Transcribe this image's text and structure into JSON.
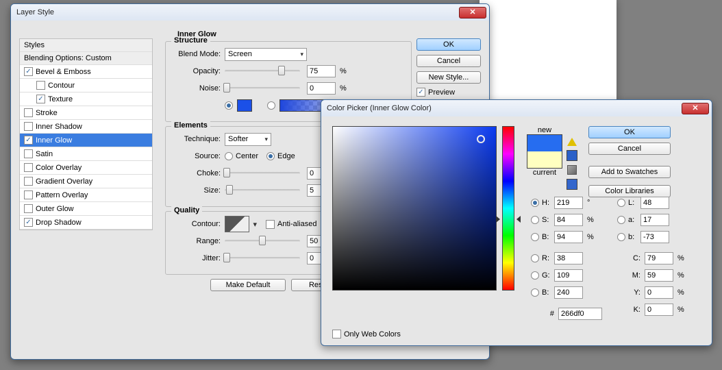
{
  "ls": {
    "title": "Layer Style",
    "panel_head": "Styles",
    "blend_opts": "Blending Options: Custom",
    "items": {
      "bevel": {
        "label": "Bevel & Emboss",
        "on": true
      },
      "contour": {
        "label": "Contour",
        "on": false
      },
      "texture": {
        "label": "Texture",
        "on": true
      },
      "stroke": {
        "label": "Stroke",
        "on": false
      },
      "innershadow": {
        "label": "Inner Shadow",
        "on": false
      },
      "innerglow": {
        "label": "Inner Glow",
        "on": true
      },
      "satin": {
        "label": "Satin",
        "on": false
      },
      "coloroverlay": {
        "label": "Color Overlay",
        "on": false
      },
      "gradoverlay": {
        "label": "Gradient Overlay",
        "on": false
      },
      "patoverlay": {
        "label": "Pattern Overlay",
        "on": false
      },
      "outerglow": {
        "label": "Outer Glow",
        "on": false
      },
      "dropshadow": {
        "label": "Drop Shadow",
        "on": true
      }
    },
    "section": "Inner Glow",
    "structure": {
      "legend": "Structure",
      "blendmode_lbl": "Blend Mode:",
      "blendmode": "Screen",
      "opacity_lbl": "Opacity:",
      "opacity": "75",
      "noise_lbl": "Noise:",
      "noise": "0",
      "pct": "%"
    },
    "elements": {
      "legend": "Elements",
      "technique_lbl": "Technique:",
      "technique": "Softer",
      "source_lbl": "Source:",
      "center": "Center",
      "edge": "Edge",
      "choke_lbl": "Choke:",
      "choke": "0",
      "size_lbl": "Size:",
      "size": "5"
    },
    "quality": {
      "legend": "Quality",
      "contour_lbl": "Contour:",
      "aa": "Anti-aliased",
      "range_lbl": "Range:",
      "range": "50",
      "jitter_lbl": "Jitter:",
      "jitter": "0"
    },
    "make_default": "Make Default",
    "reset_default": "Reset to De",
    "ok": "OK",
    "cancel": "Cancel",
    "newstyle": "New Style...",
    "preview": "Preview"
  },
  "cp": {
    "title": "Color Picker (Inner Glow Color)",
    "new_lbl": "new",
    "current_lbl": "current",
    "ok": "OK",
    "cancel": "Cancel",
    "add_swatch": "Add to Swatches",
    "libraries": "Color Libraries",
    "only_web": "Only Web Colors",
    "fields": {
      "H": {
        "lbl": "H:",
        "val": "219",
        "unit": "°"
      },
      "S": {
        "lbl": "S:",
        "val": "84",
        "unit": "%"
      },
      "B": {
        "lbl": "B:",
        "val": "94",
        "unit": "%"
      },
      "R": {
        "lbl": "R:",
        "val": "38"
      },
      "G": {
        "lbl": "G:",
        "val": "109"
      },
      "Bc": {
        "lbl": "B:",
        "val": "240"
      },
      "L": {
        "lbl": "L:",
        "val": "48"
      },
      "a": {
        "lbl": "a:",
        "val": "17"
      },
      "b": {
        "lbl": "b:",
        "val": "-73"
      },
      "C": {
        "lbl": "C:",
        "val": "79",
        "unit": "%"
      },
      "M": {
        "lbl": "M:",
        "val": "59",
        "unit": "%"
      },
      "Y": {
        "lbl": "Y:",
        "val": "0",
        "unit": "%"
      },
      "K": {
        "lbl": "K:",
        "val": "0",
        "unit": "%"
      }
    },
    "hex_lbl": "#",
    "hex": "266df0",
    "swatches": {
      "new_color": "#266df0",
      "current_color": "#ffffc0"
    }
  }
}
